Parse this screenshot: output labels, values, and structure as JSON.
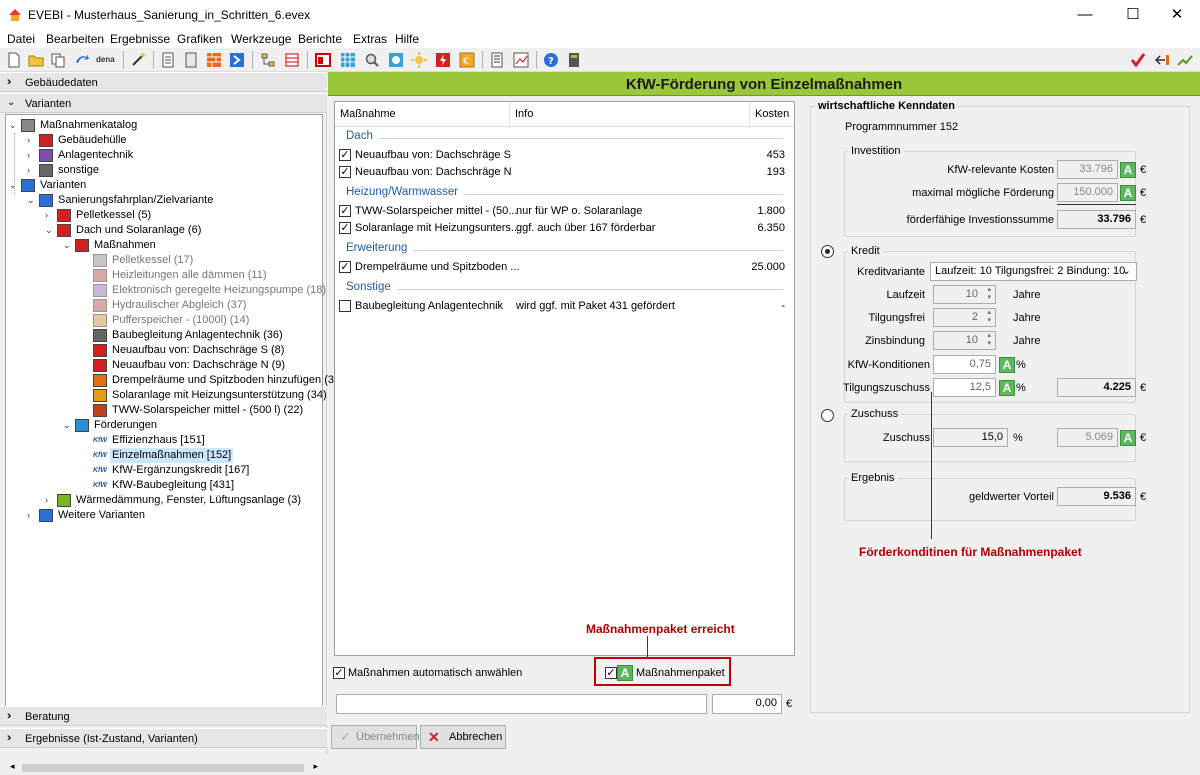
{
  "window": {
    "title": "EVEBI - Musterhaus_Sanierung_in_Schritten_6.evex",
    "minimize": "—",
    "maximize": "☐",
    "close": "✕"
  },
  "menu": [
    "Datei",
    "Bearbeiten",
    "Ergebnisse",
    "Grafiken",
    "Werkzeuge",
    "Berichte",
    "Extras",
    "Hilfe"
  ],
  "sections": {
    "gebaeudedaten": "Gebäudedaten",
    "varianten": "Varianten",
    "beratung": "Beratung",
    "ergebnisse": "Ergebnisse (Ist-Zustand, Varianten)"
  },
  "tree": [
    {
      "label": "Maßnahmenkatalog",
      "lvl": 0,
      "exp": "⌄",
      "icon": "catalog-icon"
    },
    {
      "label": "Gebäudehülle",
      "lvl": 1,
      "exp": "›",
      "icon": "house-icon"
    },
    {
      "label": "Anlagentechnik",
      "lvl": 1,
      "exp": "›",
      "icon": "heating-icon"
    },
    {
      "label": "sonstige",
      "lvl": 1,
      "exp": "›",
      "icon": "document-icon"
    },
    {
      "label": "Varianten",
      "lvl": 0,
      "exp": "⌄",
      "icon": "table-icon"
    },
    {
      "label": "Sanierungsfahrplan/Zielvariante",
      "lvl": 1,
      "exp": "⌄",
      "icon": "table-icon"
    },
    {
      "label": "Pelletkessel (5)",
      "lvl": 2,
      "exp": "›",
      "icon": "house-red-icon"
    },
    {
      "label": "Dach und Solaranlage (6)",
      "lvl": 2,
      "exp": "⌄",
      "icon": "house-red-icon"
    },
    {
      "label": "Maßnahmen",
      "lvl": 3,
      "exp": "⌄",
      "icon": "measures-icon"
    },
    {
      "label": "Pelletkessel (17)",
      "lvl": 4,
      "exp": "",
      "icon": "boiler-icon",
      "dim": true
    },
    {
      "label": "Heizleitungen alle dämmen (11)",
      "lvl": 4,
      "exp": "",
      "icon": "pipe-icon",
      "dim": true
    },
    {
      "label": "Elektronisch geregelte Heizungspumpe (18)",
      "lvl": 4,
      "exp": "",
      "icon": "pump-icon",
      "dim": true
    },
    {
      "label": "Hydraulischer Abgleich (37)",
      "lvl": 4,
      "exp": "",
      "icon": "gauge-icon",
      "dim": true
    },
    {
      "label": "Pufferspeicher - (1000l) (14)",
      "lvl": 4,
      "exp": "",
      "icon": "tank-icon",
      "dim": true
    },
    {
      "label": "Baubegleitung Anlagentechnik (36)",
      "lvl": 4,
      "exp": "",
      "icon": "document-icon"
    },
    {
      "label": "Neuaufbau von: Dachschräge S (8)",
      "lvl": 4,
      "exp": "",
      "icon": "roof-icon"
    },
    {
      "label": "Neuaufbau von: Dachschräge N (9)",
      "lvl": 4,
      "exp": "",
      "icon": "roof-icon"
    },
    {
      "label": "Drempelräume und Spitzboden hinzufügen (3)",
      "lvl": 4,
      "exp": "",
      "icon": "attic-icon"
    },
    {
      "label": "Solaranlage mit Heizungsunterstützung (34)",
      "lvl": 4,
      "exp": "",
      "icon": "solar-icon"
    },
    {
      "label": "TWW-Solarspeicher mittel - (500 l) (22)",
      "lvl": 4,
      "exp": "",
      "icon": "storage-icon"
    },
    {
      "label": "Förderungen",
      "lvl": 3,
      "exp": "⌄",
      "icon": "funding-icon"
    },
    {
      "label": "Effizienzhaus [151]",
      "lvl": 4,
      "exp": "",
      "icon": "kfw-icon"
    },
    {
      "label": "Einzelmaßnahmen [152]",
      "lvl": 4,
      "exp": "",
      "icon": "kfw-icon",
      "sel": true
    },
    {
      "label": "KfW-Ergänzungskredit [167]",
      "lvl": 4,
      "exp": "",
      "icon": "kfw-icon"
    },
    {
      "label": "KfW-Baubegleitung [431]",
      "lvl": 4,
      "exp": "",
      "icon": "kfw-icon"
    },
    {
      "label": "Wärmedämmung, Fenster, Lüftungsanlage (3)",
      "lvl": 2,
      "exp": "›",
      "icon": "house-green-icon"
    },
    {
      "label": "Weitere Varianten",
      "lvl": 1,
      "exp": "›",
      "icon": "table-icon"
    }
  ],
  "header": "KfW-Förderung von Einzelmaßnahmen",
  "list": {
    "cols": {
      "name": "Maßnahme",
      "info": "Info",
      "cost": "Kosten"
    },
    "groups": [
      {
        "title": "Dach",
        "rows": [
          {
            "name": "Neuaufbau von: Dachschräge S",
            "info": "",
            "cost": "453",
            "checked": true
          },
          {
            "name": "Neuaufbau von: Dachschräge N",
            "info": "",
            "cost": "193",
            "checked": true
          }
        ]
      },
      {
        "title": "Heizung/Warmwasser",
        "rows": [
          {
            "name": "TWW-Solarspeicher mittel - (50...",
            "info": "nur für WP o. Solaranlage",
            "cost": "1.800",
            "checked": true
          },
          {
            "name": "Solaranlage mit Heizungsunters...",
            "info": "ggf. auch über 167 förderbar",
            "cost": "6.350",
            "checked": true
          }
        ]
      },
      {
        "title": "Erweiterung",
        "rows": [
          {
            "name": "Drempelräume und Spitzboden ...",
            "info": "",
            "cost": "25.000",
            "checked": true
          }
        ]
      },
      {
        "title": "Sonstige",
        "rows": [
          {
            "name": "Baubegleitung Anlagentechnik",
            "info": "wird ggf. mit Paket 431 gefördert",
            "cost": "-",
            "checked": false
          }
        ]
      }
    ]
  },
  "bottom": {
    "auto_select": "Maßnahmen automatisch anwählen",
    "paket": "Maßnahmenpaket",
    "annotation": "Maßnahmenpaket erreicht",
    "sum": "0,00",
    "eur": "€",
    "apply": "Übernehmen",
    "cancel": "Abbrechen"
  },
  "right": {
    "title": "wirtschaftliche Kenndaten",
    "program": "Programmnummer 152",
    "investition": {
      "legend": "Investition",
      "kfw_costs_label": "KfW-relevante Kosten",
      "kfw_costs": "33.796",
      "max_label": "maximal mögliche Förderung",
      "max": "150.000",
      "sum_label": "förderfähige Investionssumme",
      "sum": "33.796"
    },
    "kredit": {
      "legend": "Kredit",
      "variant_label": "Kreditvariante",
      "variant": "Laufzeit: 10 Tilgungsfrei: 2 Bindung: 10",
      "laufzeit_label": "Laufzeit",
      "laufzeit": "10",
      "tilgungsfrei_label": "Tilgungsfrei",
      "tilgungsfrei": "2",
      "zinsbindung_label": "Zinsbindung",
      "zinsbindung": "10",
      "jahre": "Jahre",
      "konditionen_label": "KfW-Konditionen",
      "konditionen": "0,75",
      "zuschuss_label": "Tilgungszuschuss",
      "zuschuss": "12,5",
      "pct": "%",
      "result": "4.225"
    },
    "zuschuss": {
      "legend": "Zuschuss",
      "label": "Zuschuss",
      "pct_val": "15,0",
      "value": "5.069"
    },
    "ergebnis": {
      "legend": "Ergebnis",
      "label": "geldwerter Vorteil",
      "value": "9.536"
    },
    "annotation": "Förderkonditinen für Maßnahmenpaket",
    "eur": "€",
    "abtn": "A"
  }
}
